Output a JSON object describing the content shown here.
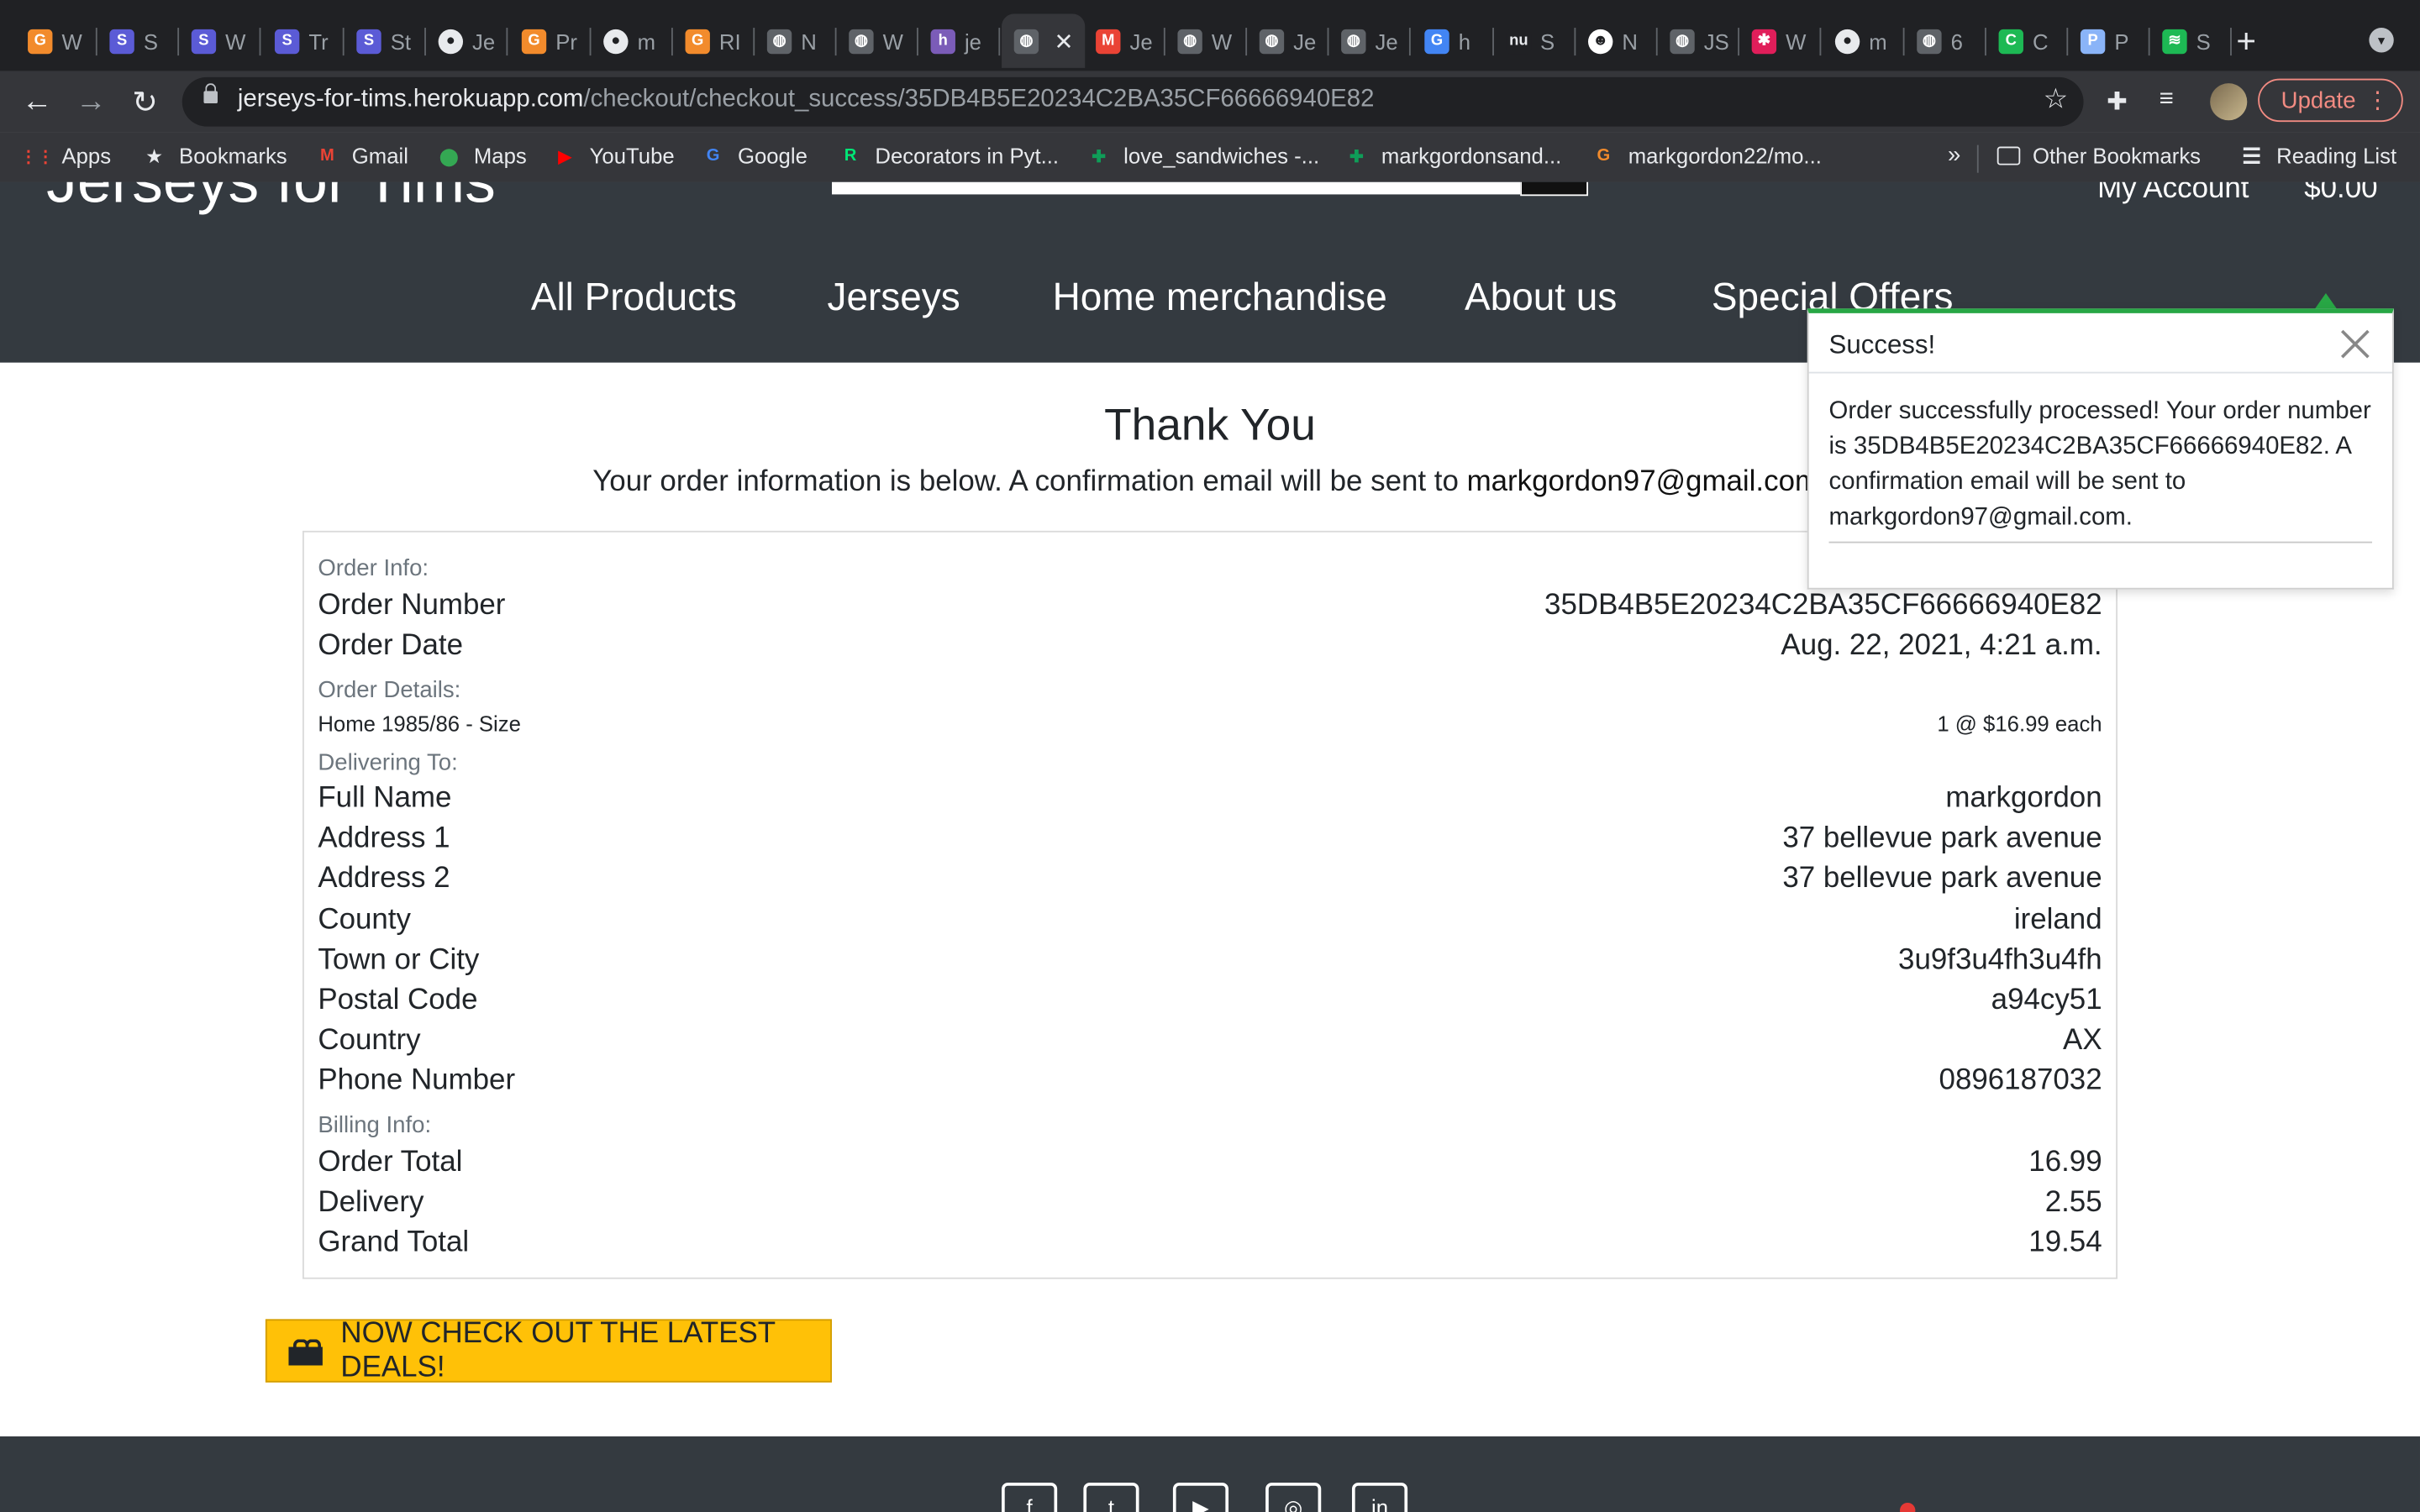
{
  "browser": {
    "tabs": [
      {
        "label": "W",
        "icon": "g-icon",
        "color": "#f28b2c",
        "glyph": "G"
      },
      {
        "label": "S",
        "icon": "s-icon",
        "color": "#5b5bd6",
        "glyph": "S"
      },
      {
        "label": "W",
        "icon": "s-icon",
        "color": "#5b5bd6",
        "glyph": "S"
      },
      {
        "label": "Tr",
        "icon": "s-icon",
        "color": "#5b5bd6",
        "glyph": "S"
      },
      {
        "label": "St",
        "icon": "s-icon",
        "color": "#5b5bd6",
        "glyph": "S"
      },
      {
        "label": "Je",
        "icon": "github-icon",
        "color": "#e8eaed",
        "glyph": "●"
      },
      {
        "label": "Pr",
        "icon": "g-icon",
        "color": "#f28b2c",
        "glyph": "G"
      },
      {
        "label": "m",
        "icon": "github-icon",
        "color": "#e8eaed",
        "glyph": "●"
      },
      {
        "label": "RI",
        "icon": "g-icon",
        "color": "#f28b2c",
        "glyph": "G"
      },
      {
        "label": "N",
        "icon": "globe-icon",
        "color": "#5f6368",
        "glyph": "◍"
      },
      {
        "label": "W",
        "icon": "globe-icon",
        "color": "#5f6368",
        "glyph": "◍"
      },
      {
        "label": "je",
        "icon": "heroku-icon",
        "color": "#7b5cb8",
        "glyph": "h"
      },
      {
        "label": "",
        "icon": "globe-icon",
        "color": "#5f6368",
        "glyph": "◍",
        "active": true
      },
      {
        "label": "Je",
        "icon": "gmail-icon",
        "color": "#ea4335",
        "glyph": "M"
      },
      {
        "label": "W",
        "icon": "globe-icon",
        "color": "#5f6368",
        "glyph": "◍"
      },
      {
        "label": "Je",
        "icon": "globe-icon",
        "color": "#5f6368",
        "glyph": "◍"
      },
      {
        "label": "Je",
        "icon": "globe-icon",
        "color": "#5f6368",
        "glyph": "◍"
      },
      {
        "label": "h",
        "icon": "google-icon",
        "color": "#4285f4",
        "glyph": "G"
      },
      {
        "label": "S",
        "icon": "nu-icon",
        "color": "#202124",
        "glyph": "nu"
      },
      {
        "label": "N",
        "icon": "smiley-icon",
        "color": "#ffffff",
        "glyph": "☻"
      },
      {
        "label": "JS",
        "icon": "globe-icon",
        "color": "#5f6368",
        "glyph": "◍"
      },
      {
        "label": "W",
        "icon": "slack-icon",
        "color": "#e01e5a",
        "glyph": "✱"
      },
      {
        "label": "m",
        "icon": "github-icon",
        "color": "#e8eaed",
        "glyph": "●"
      },
      {
        "label": "6",
        "icon": "globe-icon",
        "color": "#5f6368",
        "glyph": "◍"
      },
      {
        "label": "C",
        "icon": "c-icon",
        "color": "#1db954",
        "glyph": "C"
      },
      {
        "label": "P",
        "icon": "p-icon",
        "color": "#8ab4f8",
        "glyph": "P"
      },
      {
        "label": "S",
        "icon": "spotify-icon",
        "color": "#1db954",
        "glyph": "≋"
      }
    ],
    "close_tab_glyph": "✕",
    "new_tab_glyph": "+",
    "tab_menu_glyph": "▾",
    "url_host": "jerseys-for-tims.herokuapp.com",
    "url_path": "/checkout/checkout_success/35DB4B5E20234C2BA35CF66666940E82",
    "update_label": "Update",
    "bookmarks": [
      {
        "label": "Apps",
        "icon": "apps-grid-icon",
        "color": "#ea4335",
        "glyph": "⋮⋮"
      },
      {
        "label": "Bookmarks",
        "icon": "star-icon",
        "color": "#e8eaed",
        "glyph": "★"
      },
      {
        "label": "Gmail",
        "icon": "gmail-icon",
        "color": "#ea4335",
        "glyph": "M"
      },
      {
        "label": "Maps",
        "icon": "maps-pin-icon",
        "color": "#34a853",
        "glyph": "⬤"
      },
      {
        "label": "YouTube",
        "icon": "youtube-icon",
        "color": "#ff0000",
        "glyph": "▶"
      },
      {
        "label": "Google",
        "icon": "google-icon",
        "color": "#4285f4",
        "glyph": "G"
      },
      {
        "label": "Decorators in Pyt...",
        "icon": "realpython-icon",
        "color": "#00e676",
        "glyph": "R"
      },
      {
        "label": "love_sandwiches -...",
        "icon": "sheets-icon",
        "color": "#0f9d58",
        "glyph": "✚"
      },
      {
        "label": "markgordonsand...",
        "icon": "sheets-icon",
        "color": "#0f9d58",
        "glyph": "✚"
      },
      {
        "label": "markgordon22/mo...",
        "icon": "g-icon",
        "color": "#f28b2c",
        "glyph": "G"
      }
    ],
    "bookmarks_more": "»",
    "other_bookmarks": "Other Bookmarks",
    "reading_list": "Reading List"
  },
  "site": {
    "brand": "Jerseys for Tims",
    "account_label": "My Account",
    "cart_total": "$0.00",
    "nav": [
      "All Products",
      "Jerseys",
      "Home merchandise",
      "About us",
      "Special Offers"
    ]
  },
  "toast": {
    "title": "Success!",
    "message": "Order successfully processed! Your order number is 35DB4B5E20234C2BA35CF66666940E82. A confirmation email will be sent to markgordon97@gmail.com."
  },
  "page": {
    "heading": "Thank You",
    "subline_prefix": "Your order information is below. A confirmation email will be sent to ",
    "email": "markgordon97@gmail.com",
    "subline_suffix": "."
  },
  "order": {
    "info_label": "Order Info:",
    "number_label": "Order Number",
    "number": "35DB4B5E20234C2BA35CF66666940E82",
    "date_label": "Order Date",
    "date": "Aug. 22, 2021, 4:21 a.m.",
    "details_label": "Order Details:",
    "item_name": "Home 1985/86 - Size",
    "item_qty": "1 @ $16.99 each",
    "delivering_label": "Delivering To:",
    "fields": [
      {
        "label": "Full Name",
        "value": "markgordon"
      },
      {
        "label": "Address 1",
        "value": "37 bellevue park avenue"
      },
      {
        "label": "Address 2",
        "value": "37 bellevue park avenue"
      },
      {
        "label": "County",
        "value": "ireland"
      },
      {
        "label": "Town or City",
        "value": "3u9f3u4fh3u4fh"
      },
      {
        "label": "Postal Code",
        "value": "a94cy51"
      },
      {
        "label": "Country",
        "value": "AX"
      },
      {
        "label": "Phone Number",
        "value": "0896187032"
      }
    ],
    "billing_label": "Billing Info:",
    "billing": [
      {
        "label": "Order Total",
        "value": "16.99"
      },
      {
        "label": "Delivery",
        "value": "2.55"
      },
      {
        "label": "Grand Total",
        "value": "19.54"
      }
    ]
  },
  "deals_button": "NOW CHECK OUT THE LATEST DEALS!",
  "footer": {
    "social": [
      {
        "icon": "facebook-icon",
        "glyph": "f"
      },
      {
        "icon": "twitter-icon",
        "glyph": "t"
      },
      {
        "icon": "youtube-icon",
        "glyph": "▶"
      },
      {
        "icon": "instagram-icon",
        "glyph": "◎"
      },
      {
        "icon": "linkedin-icon",
        "glyph": "in"
      }
    ]
  }
}
